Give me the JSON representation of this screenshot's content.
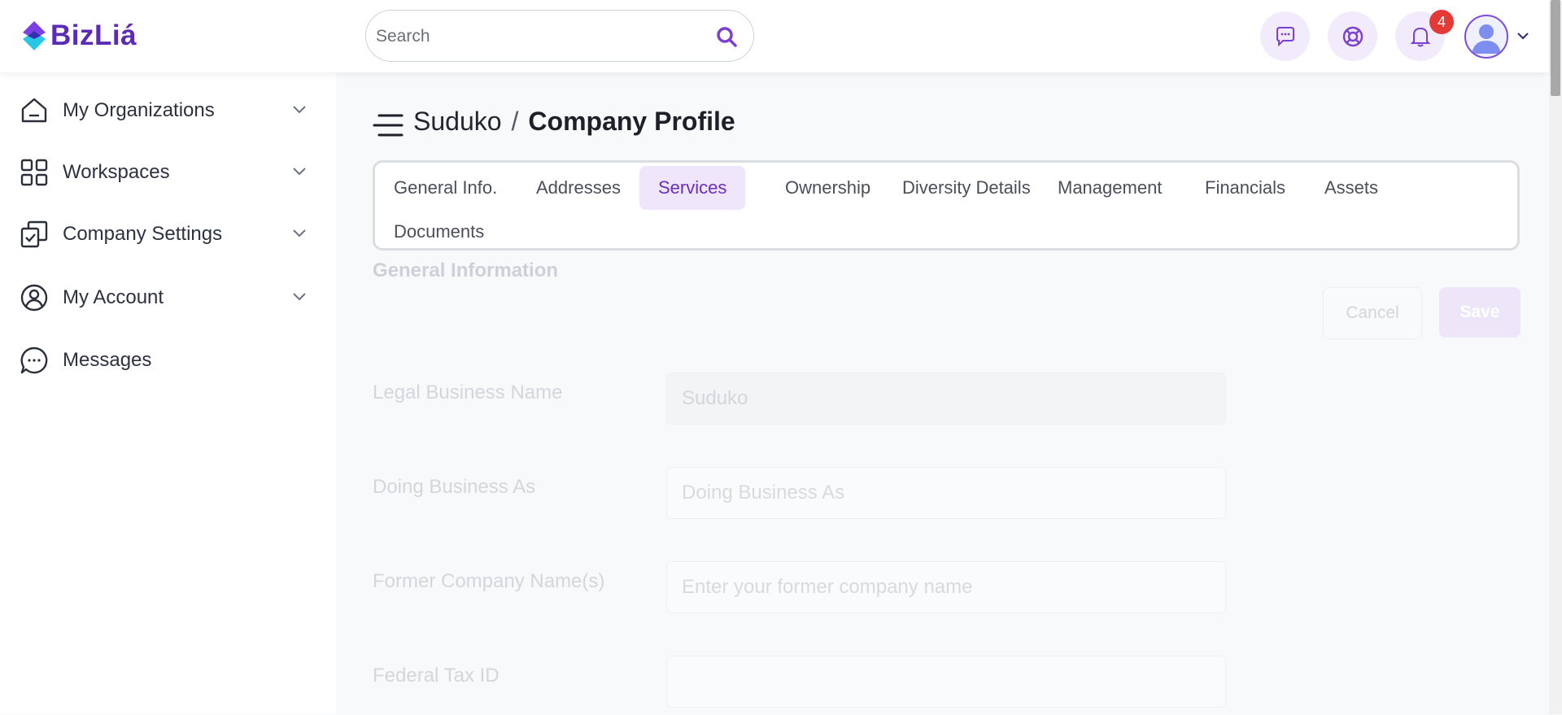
{
  "brand": {
    "name": "BizLiá"
  },
  "search": {
    "placeholder": "Search"
  },
  "header": {
    "notification_count": "4"
  },
  "sidebar": {
    "items": [
      {
        "label": "My Organizations"
      },
      {
        "label": "Workspaces"
      },
      {
        "label": "Company Settings"
      },
      {
        "label": "My Account"
      },
      {
        "label": "Messages"
      }
    ]
  },
  "breadcrumb": {
    "org": "Suduko",
    "separator": "/",
    "page": "Company Profile"
  },
  "tabs": [
    {
      "label": "General Info."
    },
    {
      "label": "Addresses"
    },
    {
      "label": "Services",
      "active": true
    },
    {
      "label": "Ownership"
    },
    {
      "label": "Diversity Details"
    },
    {
      "label": "Management"
    },
    {
      "label": "Financials"
    },
    {
      "label": "Assets"
    },
    {
      "label": "Documents"
    }
  ],
  "form": {
    "section_title": "General Information",
    "cancel_label": "Cancel",
    "save_label": "Save",
    "fields": [
      {
        "label": "Legal Business Name",
        "value": "Suduko",
        "placeholder": ""
      },
      {
        "label": "Doing Business As",
        "value": "",
        "placeholder": "Doing Business As"
      },
      {
        "label": "Former Company Name(s)",
        "value": "",
        "placeholder": "Enter your former company name"
      },
      {
        "label": "Federal Tax ID",
        "value": "",
        "placeholder": ""
      }
    ]
  },
  "colors": {
    "accent": "#6b2fc0",
    "active_tab_bg": "#efe6fb",
    "badge": "#e53935"
  }
}
